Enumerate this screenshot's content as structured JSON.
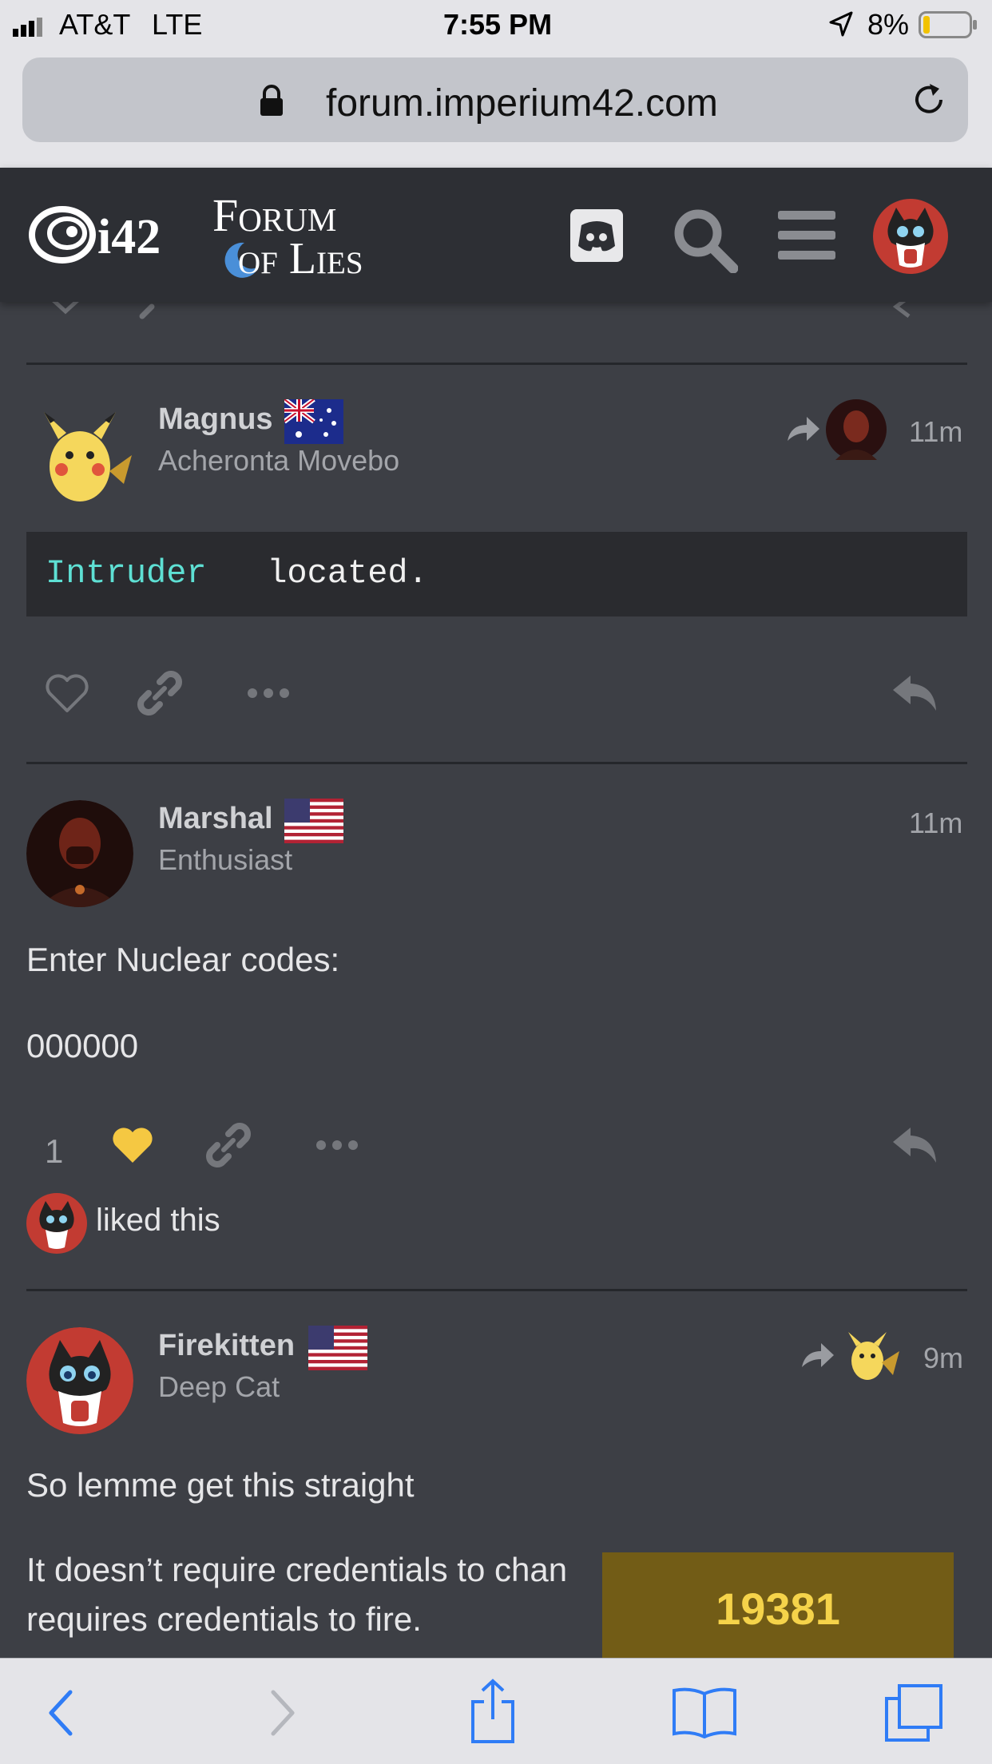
{
  "status_bar": {
    "carrier": "AT&T",
    "network": "LTE",
    "time": "7:55 PM",
    "battery": "8%"
  },
  "browser": {
    "url": "forum.imperium42.com"
  },
  "header": {
    "logo_i42": "i42",
    "logo_line1": "Forum",
    "logo_line2": "of Lies"
  },
  "posts": [
    {
      "username": "Magnus",
      "user_title": "Acheronta Movebo",
      "time": "11m",
      "code_keyword": "Intruder",
      "code_rest": " located."
    },
    {
      "username": "Marshal",
      "user_title": "Enthusiast",
      "time": "11m",
      "line1": "Enter Nuclear codes:",
      "line2": "000000",
      "like_count": "1",
      "liked_text": "liked this"
    },
    {
      "username": "Firekitten",
      "user_title": "Deep Cat",
      "time": "9m",
      "line1": "So lemme get this straight",
      "line2": "It doesn’t require credentials to chan",
      "line3": "requires credentials to fire."
    }
  ],
  "counter": {
    "value": "19381"
  },
  "colors": {
    "like_heart": "#f5c842",
    "code_keyword": "#5ee0d4",
    "counter_bg": "#725c16"
  }
}
